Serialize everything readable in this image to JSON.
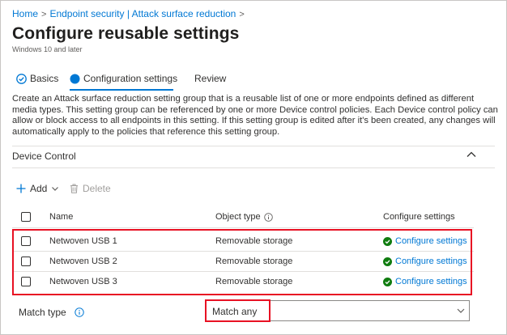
{
  "breadcrumb": {
    "items": [
      "Home",
      "Endpoint security | Attack surface reduction"
    ],
    "separator": ">"
  },
  "page": {
    "title": "Configure reusable settings",
    "more_label": "...",
    "subtitle": "Windows 10 and later"
  },
  "tabs": [
    {
      "label": "Basics",
      "state": "completed"
    },
    {
      "label": "Configuration settings",
      "state": "current"
    },
    {
      "label": "Review",
      "state": "pending"
    }
  ],
  "description": "Create an Attack surface reduction setting group that is a reusable list of one or more endpoints defined as different media types. This setting group can be referenced by one or more Device control policies. Each Device control policy can allow or block access to all endpoints in this setting. If this setting group is edited after it's been created, any changes will automatically apply to the policies that reference this setting group.",
  "section": {
    "title": "Device Control",
    "expanded": true
  },
  "toolbar": {
    "add_label": "Add",
    "delete_label": "Delete"
  },
  "table": {
    "headers": {
      "name": "Name",
      "object_type": "Object type",
      "configure": "Configure settings"
    },
    "rows": [
      {
        "name": "Netwoven USB 1",
        "object_type": "Removable storage",
        "configure": "Configure settings",
        "checked": false
      },
      {
        "name": "Netwoven USB 2",
        "object_type": "Removable storage",
        "configure": "Configure settings",
        "checked": false
      },
      {
        "name": "Netwoven USB 3",
        "object_type": "Removable storage",
        "configure": "Configure settings",
        "checked": false
      }
    ]
  },
  "match_type": {
    "label": "Match type",
    "value": "Match any"
  },
  "colors": {
    "accent": "#0078d4",
    "success": "#107c10",
    "highlight": "#e81123"
  },
  "icons": {
    "completed_step": "check-circle-icon",
    "current_step": "filled-circle-icon",
    "info": "info-icon",
    "add": "plus-icon",
    "delete": "trash-icon",
    "collapse": "chevron-up-icon",
    "dropdown": "chevron-down-icon",
    "status": "success-check-icon"
  }
}
